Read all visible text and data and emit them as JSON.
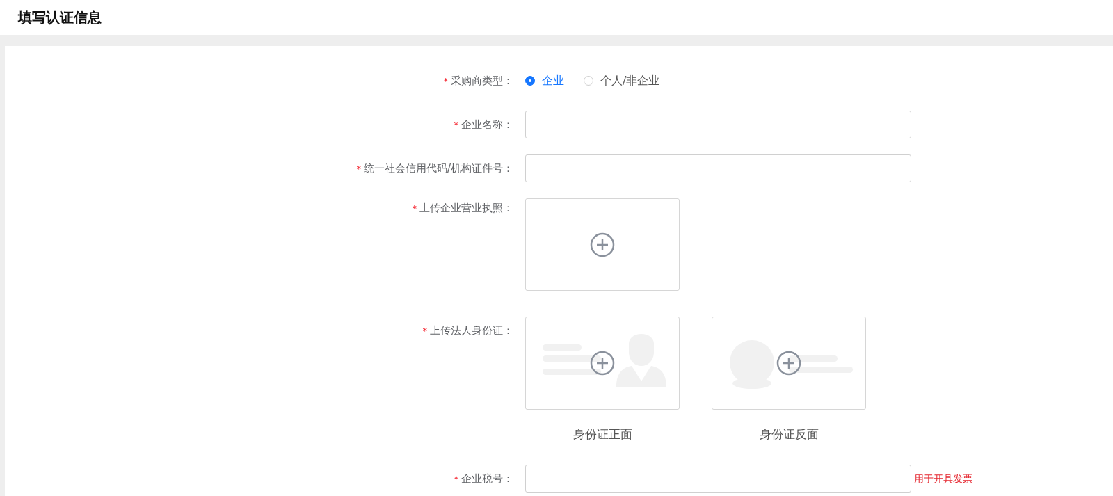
{
  "page": {
    "title": "填写认证信息"
  },
  "fields": [
    {
      "kind": "radio",
      "mark": "*",
      "label": "采购商类型：",
      "options": [
        {
          "label": "企业",
          "selected": true
        },
        {
          "label": "个人/非企业",
          "selected": false
        }
      ]
    },
    {
      "kind": "input",
      "mark": "*",
      "label": "企业名称："
    },
    {
      "kind": "input",
      "mark": "*",
      "label": "统一社会信用代码/机构证件号："
    },
    {
      "kind": "upload",
      "mark": "*",
      "label": "上传企业营业执照："
    },
    {
      "kind": "id-upload",
      "mark": "*",
      "label": "上传法人身份证：",
      "cards": [
        {
          "kind": "front",
          "caption": "身份证正面"
        },
        {
          "kind": "back",
          "caption": "身份证反面"
        }
      ]
    },
    {
      "kind": "input",
      "mark": "*",
      "label": "企业税号：",
      "hint": "用于开具发票"
    }
  ]
}
